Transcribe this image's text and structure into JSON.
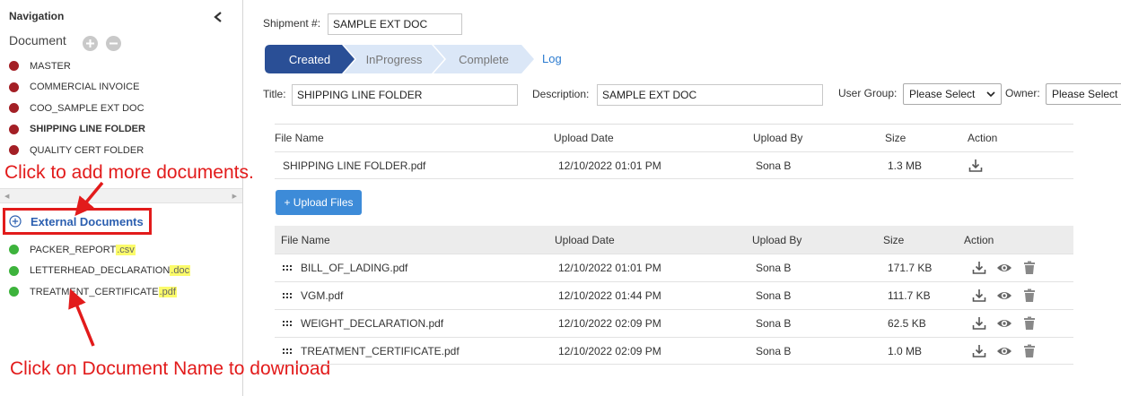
{
  "sidebar": {
    "title": "Navigation",
    "document_header": "Document",
    "documents": [
      {
        "label": "MASTER",
        "active": false
      },
      {
        "label": "COMMERCIAL INVOICE",
        "active": false
      },
      {
        "label": "COO_SAMPLE EXT DOC",
        "active": false
      },
      {
        "label": "SHIPPING LINE FOLDER",
        "active": true
      },
      {
        "label": "QUALITY CERT FOLDER",
        "active": false
      }
    ],
    "external_header": "External Documents",
    "external_documents": [
      {
        "name": "PACKER_REPORT",
        "ext": ".csv"
      },
      {
        "name": "LETTERHEAD_DECLARATION",
        "ext": ".doc"
      },
      {
        "name": "TREATMENT_CERTIFICATE",
        "ext": ".pdf"
      }
    ],
    "document_dot_color": "#a31f25",
    "external_dot_color": "#3db33c"
  },
  "annotations": {
    "add_more": "Click to add more documents.",
    "download": "Click on Document Name to download"
  },
  "main": {
    "shipment_label": "Shipment #:",
    "shipment_value": "SAMPLE EXT DOC",
    "steps": [
      {
        "label": "Created",
        "state": "active"
      },
      {
        "label": "InProgress",
        "state": "pending"
      },
      {
        "label": "Complete",
        "state": "pending"
      }
    ],
    "log_label": "Log",
    "title_label": "Title:",
    "title_value": "SHIPPING LINE FOLDER",
    "description_label": "Description:",
    "description_value": "SAMPLE EXT DOC",
    "user_group_label": "User Group:",
    "user_group_value": "Please Select",
    "owner_label": "Owner:",
    "owner_value": "Please Select"
  },
  "table1": {
    "headers": [
      "File Name",
      "Upload Date",
      "Upload By",
      "Size",
      "Action"
    ],
    "rows": [
      {
        "name": "SHIPPING LINE FOLDER.pdf",
        "date": "12/10/2022 01:01 PM",
        "by": "Sona B",
        "size": "1.3 MB"
      }
    ]
  },
  "upload_button": "+ Upload Files",
  "table2": {
    "headers": [
      "File Name",
      "Upload Date",
      "Upload By",
      "Size",
      "Action"
    ],
    "rows": [
      {
        "name": "BILL_OF_LADING.pdf",
        "date": "12/10/2022 01:01 PM",
        "by": "Sona B",
        "size": "171.7 KB"
      },
      {
        "name": "VGM.pdf",
        "date": "12/10/2022 01:44 PM",
        "by": "Sona B",
        "size": "111.7 KB"
      },
      {
        "name": "WEIGHT_DECLARATION.pdf",
        "date": "12/10/2022 02:09 PM",
        "by": "Sona B",
        "size": "62.5 KB"
      },
      {
        "name": "TREATMENT_CERTIFICATE.pdf",
        "date": "12/10/2022 02:09 PM",
        "by": "Sona B",
        "size": "1.0 MB"
      }
    ]
  },
  "icons": {
    "collapse": "chevron-left-icon",
    "add": "plus-circle-icon",
    "remove": "minus-circle-icon",
    "download": "download-icon",
    "view": "eye-icon",
    "delete": "trash-icon",
    "drag": "drag-handle-icon"
  },
  "colors": {
    "step_active": "#2a4f96",
    "step_pending": "#dbe7f7",
    "primary_button": "#3d8bd8",
    "annotation": "#e21b1b",
    "highlight": "#fbfb6a"
  }
}
